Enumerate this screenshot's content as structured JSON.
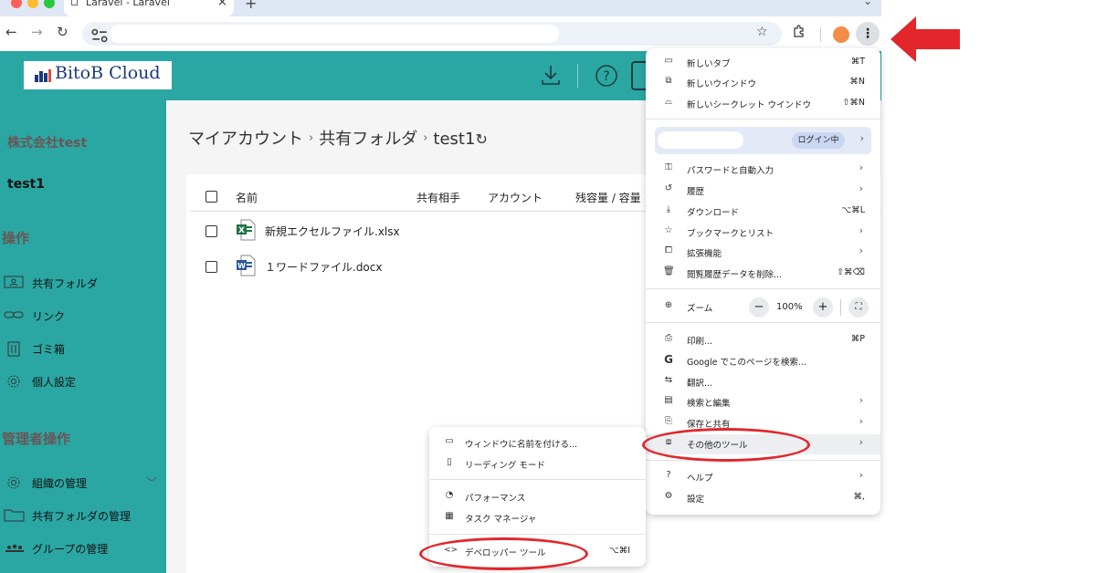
{
  "browser": {
    "tab_title": "Laravel - Laravel",
    "tab_close": "×",
    "new_tab": "+",
    "tab_menu": "⌄",
    "back": "←",
    "forward": "→",
    "reload": "↻",
    "star": "☆",
    "menu_dots": "⋮",
    "profile_color": "#f28c46",
    "accent": "#2aa7a3"
  },
  "app": {
    "logo_text": "BitoB Cloud",
    "sidebar": {
      "company": "株式会社test",
      "user": "test1",
      "section_ops": "操作",
      "ops_items": [
        {
          "label": "共有フォルダ",
          "icon": "shared-folder-icon"
        },
        {
          "label": "リンク",
          "icon": "link-icon"
        },
        {
          "label": "ゴミ箱",
          "icon": "trash-icon"
        },
        {
          "label": "個人設定",
          "icon": "gear-icon"
        }
      ],
      "section_admin": "管理者操作",
      "admin_items": [
        {
          "label": "組織の管理",
          "icon": "gear-icon"
        },
        {
          "label": "共有フォルダの管理",
          "icon": "folder-icon"
        },
        {
          "label": "グループの管理",
          "icon": "group-icon"
        }
      ]
    },
    "breadcrumb": {
      "items": [
        "マイアカウント",
        "共有フォルダ",
        "test1"
      ],
      "sep": "›",
      "refresh": "↻"
    },
    "table": {
      "headers": [
        "名前",
        "共有相手",
        "アカウント",
        "残容量 / 容量"
      ],
      "files": [
        {
          "name": "新規エクセルファイル.xlsx",
          "type": "excel-icon",
          "badge": "X"
        },
        {
          "name": "１ワードファイル.docx",
          "type": "word-icon",
          "badge": "W"
        }
      ]
    }
  },
  "chrome_menu": {
    "group1": [
      {
        "icon": "▭",
        "label": "新しいタブ",
        "shortcut": "⌘T"
      },
      {
        "icon": "⧉",
        "label": "新しいウインドウ",
        "shortcut": "⌘N"
      },
      {
        "icon": "⌓",
        "label": "新しいシークレット ウインドウ",
        "shortcut": "⇧⌘N"
      }
    ],
    "profile_badge": "ログイン中",
    "group2": [
      {
        "icon": "⚿",
        "label": "パスワードと自動入力",
        "arrow": "›"
      },
      {
        "icon": "↺",
        "label": "履歴",
        "arrow": "›"
      },
      {
        "icon": "⤓",
        "label": "ダウンロード",
        "shortcut": "⌥⌘L"
      },
      {
        "icon": "☆",
        "label": "ブックマークとリスト",
        "arrow": "›"
      },
      {
        "icon": "⧠",
        "label": "拡張機能",
        "arrow": "›"
      },
      {
        "icon": "🗑",
        "label": "閲覧履歴データを削除...",
        "shortcut": "⇧⌘⌫"
      }
    ],
    "zoom": {
      "icon": "⊕",
      "label": "ズーム",
      "minus": "−",
      "value": "100%",
      "plus": "+",
      "fullscreen": "⛶"
    },
    "group3": [
      {
        "icon": "⎙",
        "label": "印刷...",
        "shortcut": "⌘P"
      },
      {
        "icon": "G",
        "label": "Google でこのページを検索..."
      },
      {
        "icon": "⇆",
        "label": "翻訳..."
      },
      {
        "icon": "▤",
        "label": "検索と編集",
        "arrow": "›"
      },
      {
        "icon": "⎘",
        "label": "保存と共有",
        "arrow": "›"
      },
      {
        "icon": "⧈",
        "label": "その他のツール",
        "arrow": "›"
      }
    ],
    "group4": [
      {
        "icon": "?",
        "label": "ヘルプ",
        "arrow": "›"
      },
      {
        "icon": "⚙",
        "label": "設定",
        "shortcut": "⌘,"
      }
    ]
  },
  "submenu": {
    "group1": [
      {
        "icon": "▭",
        "label": "ウィンドウに名前を付ける..."
      },
      {
        "icon": "▯",
        "label": "リーディング モード"
      }
    ],
    "group2": [
      {
        "icon": "◔",
        "label": "パフォーマンス"
      },
      {
        "icon": "▦",
        "label": "タスク マネージャ"
      }
    ],
    "group3": [
      {
        "icon": "<>",
        "label": "デベロッパー ツール",
        "shortcut": "⌥⌘I"
      }
    ]
  },
  "annotation_color": "#e3262c"
}
